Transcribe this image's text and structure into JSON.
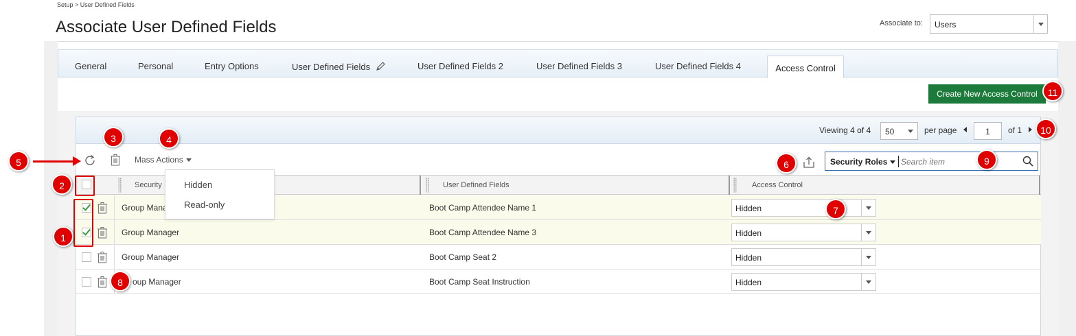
{
  "breadcrumb": "Setup > User Defined Fields",
  "page_title": "Associate User Defined Fields",
  "associate": {
    "label": "Associate to:",
    "value": "Users"
  },
  "tabs": [
    {
      "label": "General"
    },
    {
      "label": "Personal"
    },
    {
      "label": "Entry Options"
    },
    {
      "label": "User Defined Fields"
    },
    {
      "label": "User Defined Fields 2"
    },
    {
      "label": "User Defined Fields 3"
    },
    {
      "label": "User Defined Fields 4"
    },
    {
      "label": "Access Control",
      "active": true
    }
  ],
  "create_button": "Create New Access Control",
  "pagination": {
    "viewing_prefix": "Viewing",
    "viewing_count": "4 of 4",
    "per_page_value": "50",
    "per_page_label": "per page",
    "page": "1",
    "of_label": "of 1"
  },
  "toolbar": {
    "mass_actions": "Mass Actions",
    "search_scope": "Security Roles",
    "search_placeholder": "Search item"
  },
  "mass_menu": [
    "Hidden",
    "Read-only"
  ],
  "columns": {
    "security": "Security",
    "udf": "User Defined Fields",
    "access": "Access Control"
  },
  "rows": [
    {
      "role": "Group Mana",
      "field": "Boot Camp Attendee Name 1",
      "access": "Hidden",
      "checked": true
    },
    {
      "role": "Group Manager",
      "field": "Boot Camp Attendee Name 3",
      "access": "Hidden",
      "checked": true
    },
    {
      "role": "Group Manager",
      "field": "Boot Camp Seat 2",
      "access": "Hidden",
      "checked": false
    },
    {
      "role": "oup Manager",
      "field": "Boot Camp Seat Instruction",
      "access": "Hidden",
      "checked": false
    }
  ],
  "annotations": [
    "1",
    "2",
    "3",
    "4",
    "5",
    "6",
    "7",
    "8",
    "9",
    "10",
    "11"
  ],
  "colors": {
    "annotation_red": "#e00000",
    "create_button_green": "#1c7a3a",
    "checkmark_green": "#3a9c3a"
  }
}
